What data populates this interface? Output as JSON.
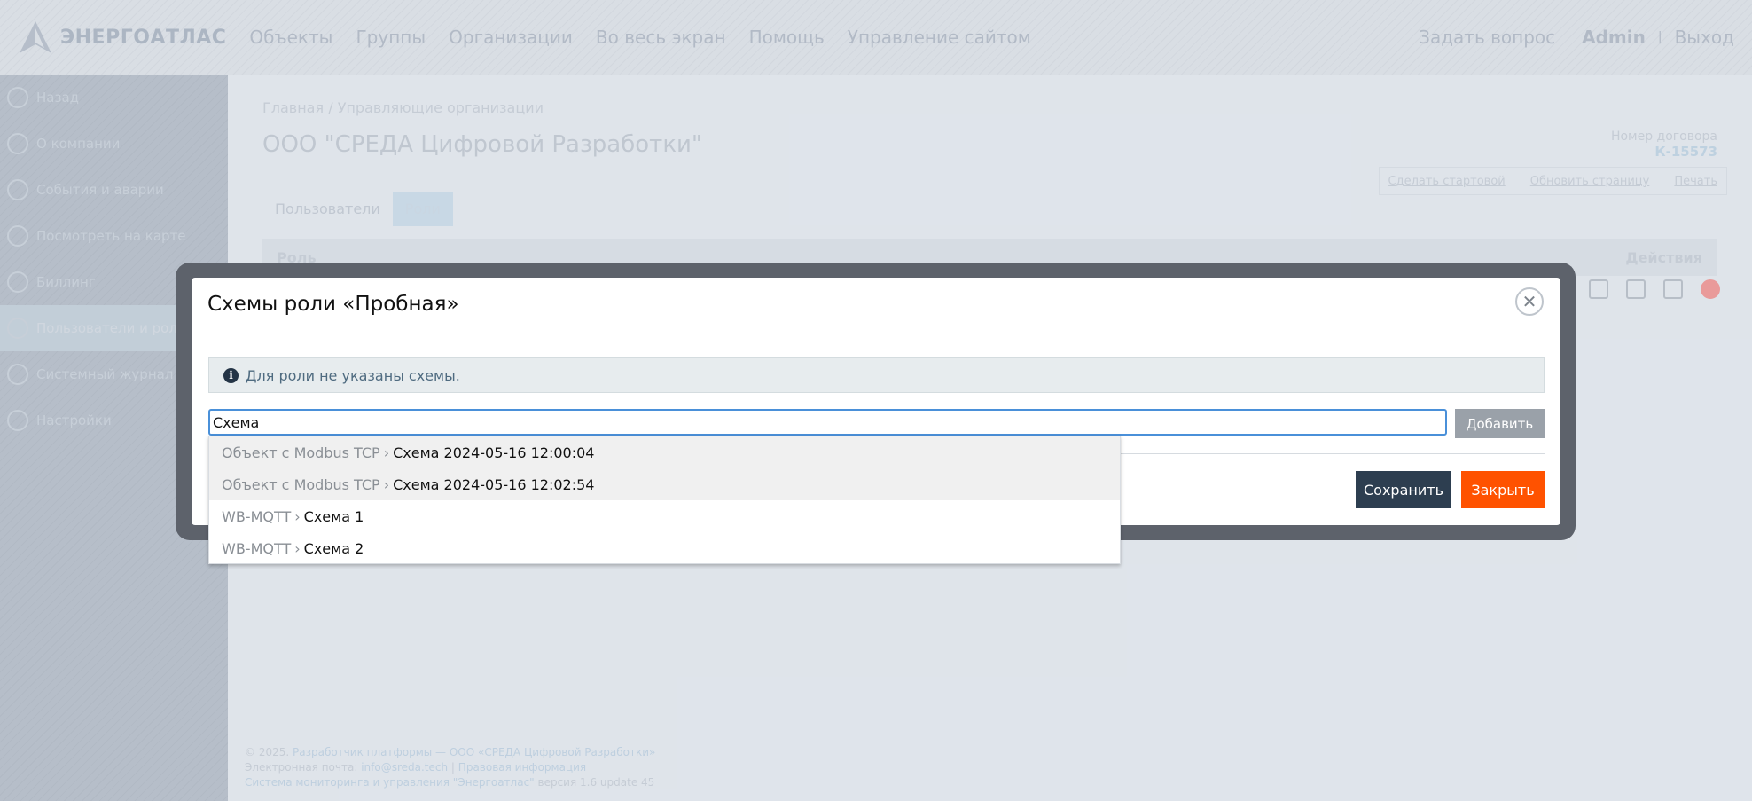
{
  "header": {
    "brand": "ЭНЕРГОАТЛАС",
    "nav": [
      "Объекты",
      "Группы",
      "Организации",
      "Во весь экран",
      "Помощь",
      "Управление сайтом"
    ],
    "ask_question": "Задать вопрос",
    "user": "Admin",
    "separator": "|",
    "logout": "Выход"
  },
  "sidebar": {
    "items": [
      {
        "label": "Назад",
        "icon": "back-arrow-icon"
      },
      {
        "label": "О компании",
        "icon": "info-icon"
      },
      {
        "label": "События и аварии",
        "icon": "alert-icon"
      },
      {
        "label": "Посмотреть на карте",
        "icon": "map-icon"
      },
      {
        "label": "Биллинг",
        "icon": "billing-icon"
      },
      {
        "label": "Пользователи и роли",
        "icon": "users-icon",
        "active": true
      },
      {
        "label": "Системный журнал",
        "icon": "journal-icon"
      },
      {
        "label": "Настройки",
        "icon": "gear-icon"
      }
    ]
  },
  "main": {
    "breadcrumb": {
      "home": "Главная",
      "sep": "/",
      "section": "Управляющие организации"
    },
    "title": "ООО \"СРЕДА Цифровой Разработки\"",
    "contract_label": "Номер договора",
    "contract_number": "К-15573",
    "actions": {
      "make_start": "Сделать стартовой",
      "refresh": "Обновить страницу",
      "print": "Печать"
    },
    "tabs": [
      "Пользователи",
      "Роли"
    ],
    "active_tab": 1,
    "table": {
      "col_role": "Роль",
      "col_actions": "Действия"
    }
  },
  "modal": {
    "title": "Схемы роли «Пробная»",
    "info": "Для роли не указаны схемы.",
    "search_value": "Схема",
    "add_label": "Добавить",
    "save_label": "Сохранить",
    "close_label": "Закрыть"
  },
  "dropdown": {
    "items": [
      {
        "group": "Объект с Modbus TCP",
        "name": "Схема 2024-05-16 12:00:04",
        "highlighted": true
      },
      {
        "group": "Объект с Modbus TCP",
        "name": "Схема 2024-05-16 12:02:54",
        "highlighted": true
      },
      {
        "group": "WB-MQTT",
        "name": "Схема 1",
        "highlighted": false
      },
      {
        "group": "WB-MQTT",
        "name": "Схема 2",
        "highlighted": false
      }
    ],
    "separator": "›"
  },
  "footer": {
    "copyright": "© 2025.",
    "developer_link": "Разработчик платформы — ООО «СРЕДА Цифровой Разработки»",
    "email_label": "Электронная почта:",
    "email": "info@sreda.tech",
    "pipe": "|",
    "legal": "Правовая информация",
    "system_name": "Система мониторинга и управления \"Энергоатлас\"",
    "version": "версия 1.6 update 45"
  },
  "colors": {
    "accent_orange": "#ff5200",
    "dark_button": "#2d3e50",
    "info_icon": "#243446",
    "input_focus": "#4a90d9"
  }
}
